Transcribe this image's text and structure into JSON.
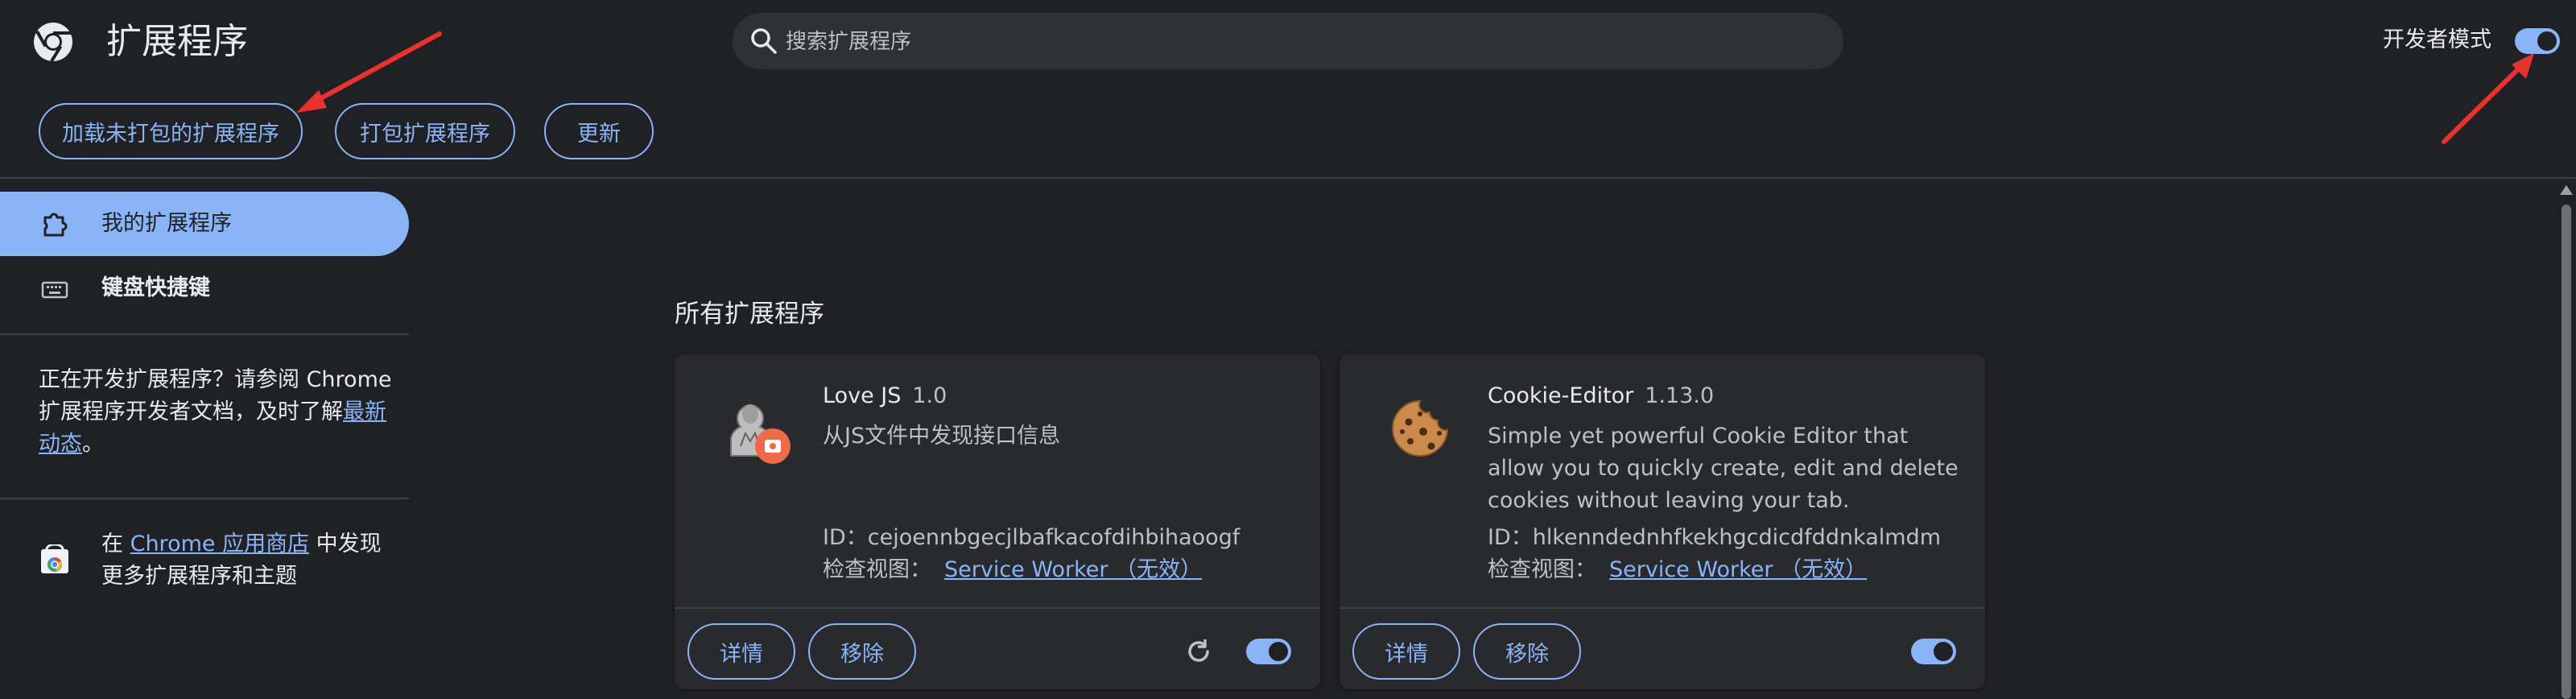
{
  "header": {
    "title": "扩展程序",
    "search_placeholder": "搜索扩展程序",
    "dev_mode_label": "开发者模式",
    "dev_mode_on": true
  },
  "toolbar": {
    "load_unpacked": "加载未打包的扩展程序",
    "pack_extension": "打包扩展程序",
    "update": "更新"
  },
  "sidebar": {
    "items": [
      {
        "label": "我的扩展程序",
        "active": true
      },
      {
        "label": "键盘快捷键",
        "active": false
      }
    ],
    "dev_text_1": "正在开发扩展程序？请参阅 Chrome 扩展程序开发者文档，及时了解",
    "dev_link": "最新动态",
    "dev_text_end": "。",
    "store_prefix": "在 ",
    "store_link": "Chrome 应用商店",
    "store_suffix": " 中发现更多扩展程序和主题"
  },
  "main": {
    "section_title": "所有扩展程序",
    "extensions": [
      {
        "name": "Love JS",
        "version": "1.0",
        "description": "从JS文件中发现接口信息",
        "id_label": "ID：",
        "id": "cejoennbgecjlbafkacofdihbihaoogf",
        "inspect_label": "检查视图：",
        "inspect_link": "Service Worker （无效）",
        "details": "详情",
        "remove": "移除",
        "enabled": true,
        "has_reload": true
      },
      {
        "name": "Cookie-Editor",
        "version": "1.13.0",
        "description": "Simple yet powerful Cookie Editor that allow you to quickly create, edit and delete cookies without leaving your tab.",
        "id_label": "ID：",
        "id": "hlkenndednhfkekhgcdicdfddnkalmdm",
        "inspect_label": "检查视图：",
        "inspect_link": "Service Worker （无效）",
        "details": "详情",
        "remove": "移除",
        "enabled": true,
        "has_reload": false
      }
    ]
  },
  "colors": {
    "background": "#202124",
    "accent": "#8ab4f8",
    "card": "#292a2d",
    "annotation_arrow": "#e8322e"
  },
  "icons": [
    "chrome-logo-icon",
    "search-icon",
    "extensions-puzzle-icon",
    "keyboard-icon",
    "chrome-web-store-icon",
    "reload-icon",
    "cookie-icon",
    "lovejs-icon"
  ]
}
